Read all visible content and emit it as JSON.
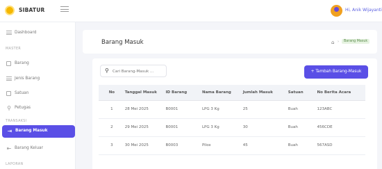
{
  "app": {
    "name": "SIBATUR"
  },
  "topbar": {
    "greeting": "Hi, Anik Wijayanti"
  },
  "sidebar": {
    "items": [
      {
        "label": "Dashboard",
        "icon": "dashboard-icon"
      },
      {
        "section": "MASTER"
      },
      {
        "label": "Barang",
        "icon": "box-icon"
      },
      {
        "label": "Jenis Barang",
        "icon": "list-icon"
      },
      {
        "label": "Satuan",
        "icon": "unit-icon"
      },
      {
        "label": "Petugas",
        "icon": "user-icon"
      },
      {
        "section": "TRANSAKSI"
      },
      {
        "label": "Barang Masuk",
        "icon": "inbox-in-icon",
        "active": true
      },
      {
        "label": "Barang Keluar",
        "icon": "inbox-out-icon"
      },
      {
        "section": "LAPORAN"
      }
    ]
  },
  "page": {
    "title": "Barang Masuk",
    "breadcrumb_current": "Barang Masuk"
  },
  "toolbar": {
    "search_placeholder": "Cari Barang-Masuk ...",
    "add_label": "+  Tambah Barang-Masuk"
  },
  "table": {
    "headers": [
      "No",
      "Tanggal Masuk",
      "ID Barang",
      "Nama Barang",
      "Jumlah Masuk",
      "Satuan",
      "No Berita Acara"
    ],
    "rows": [
      [
        "1",
        "28 Mei 2025",
        "B0001",
        "LPG 3 Kg",
        "25",
        "Buah",
        "123ABC"
      ],
      [
        "2",
        "29 Mei 2025",
        "B0001",
        "LPG 3 Kg",
        "30",
        "Buah",
        "456CDE"
      ],
      [
        "3",
        "30 Mei 2025",
        "B0003",
        "Pilox",
        "45",
        "Buah",
        "567ASD"
      ]
    ]
  },
  "colors": {
    "accent": "#5a4fe6",
    "brand": "#f5b700"
  }
}
